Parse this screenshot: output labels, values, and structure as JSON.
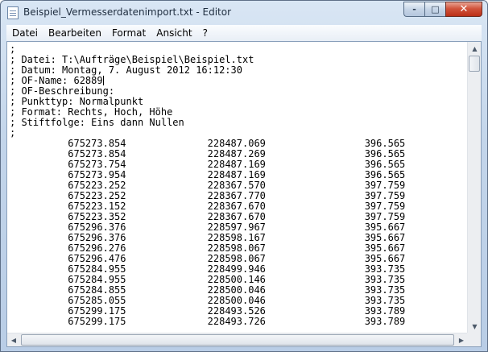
{
  "window": {
    "title": "Beispiel_Vermesserdatenimport.txt - Editor"
  },
  "caption_buttons": {
    "minimize": "-",
    "maximize": "□",
    "close": "✕"
  },
  "menu": [
    "Datei",
    "Bearbeiten",
    "Format",
    "Ansicht",
    "?"
  ],
  "header_lines": [
    ";",
    "; Datei: T:\\Aufträge\\Beispiel\\Beispiel.txt",
    "; Datum: Montag, 7. August 2012 16:12:30",
    "; OF-Name: 62889",
    "; OF-Beschreibung:",
    "; Punkttyp: Normalpunkt",
    "; Format: Rechts, Hoch, Höhe",
    "; Stiftfolge: Eins dann Nullen",
    ";"
  ],
  "data_rows": [
    [
      "675273.854",
      "228487.069",
      "396.565"
    ],
    [
      "675273.854",
      "228487.269",
      "396.565"
    ],
    [
      "675273.754",
      "228487.169",
      "396.565"
    ],
    [
      "675273.954",
      "228487.169",
      "396.565"
    ],
    [
      "675223.252",
      "228367.570",
      "397.759"
    ],
    [
      "675223.252",
      "228367.770",
      "397.759"
    ],
    [
      "675223.152",
      "228367.670",
      "397.759"
    ],
    [
      "675223.352",
      "228367.670",
      "397.759"
    ],
    [
      "675296.376",
      "228597.967",
      "395.667"
    ],
    [
      "675296.376",
      "228598.167",
      "395.667"
    ],
    [
      "675296.276",
      "228598.067",
      "395.667"
    ],
    [
      "675296.476",
      "228598.067",
      "395.667"
    ],
    [
      "675284.955",
      "228499.946",
      "393.735"
    ],
    [
      "675284.955",
      "228500.146",
      "393.735"
    ],
    [
      "675284.855",
      "228500.046",
      "393.735"
    ],
    [
      "675285.055",
      "228500.046",
      "393.735"
    ],
    [
      "675299.175",
      "228493.526",
      "393.789"
    ],
    [
      "675299.175",
      "228493.726",
      "393.789"
    ]
  ],
  "scroll_icons": {
    "up": "▲",
    "down": "▼",
    "left": "◀",
    "right": "▶"
  }
}
